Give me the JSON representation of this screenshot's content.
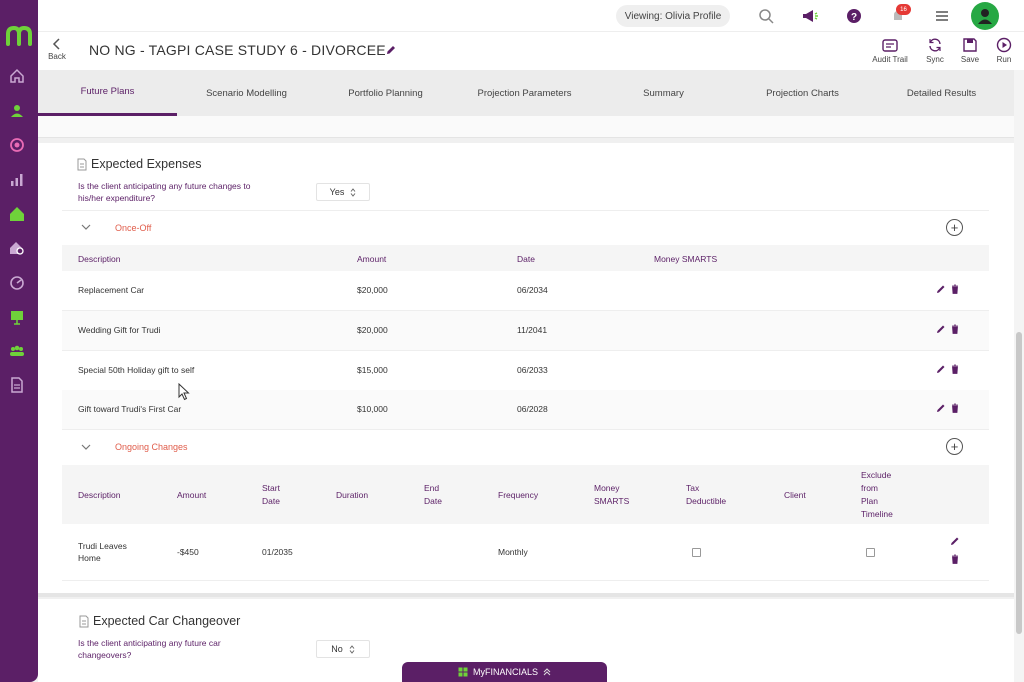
{
  "topbar": {
    "viewing": "Viewing: Olivia Profile",
    "notification_count": "16",
    "icons": [
      "search-icon",
      "megaphone-icon",
      "help-icon",
      "bell-icon",
      "menu-icon",
      "user-avatar-icon"
    ]
  },
  "header": {
    "back_label": "Back",
    "title": "NO NG - TAGPI CASE STUDY 6 - DIVORCEE",
    "tools": [
      {
        "label": "Audit Trail",
        "icon": "audit-trail-icon"
      },
      {
        "label": "Sync",
        "icon": "sync-icon"
      },
      {
        "label": "Save",
        "icon": "save-icon"
      },
      {
        "label": "Run",
        "icon": "run-icon"
      }
    ]
  },
  "tabs": [
    {
      "label": "Future Plans",
      "active": true
    },
    {
      "label": "Scenario Modelling"
    },
    {
      "label": "Portfolio Planning"
    },
    {
      "label": "Projection Parameters"
    },
    {
      "label": "Summary"
    },
    {
      "label": "Projection Charts"
    },
    {
      "label": "Detailed Results"
    }
  ],
  "expenses": {
    "title": "Expected Expenses",
    "question_line1": "Is the client anticipating any future changes to",
    "question_line2": "his/her expenditure?",
    "answer": "Yes",
    "once_off": {
      "label": "Once-Off",
      "headers": [
        "Description",
        "Amount",
        "Date",
        "Money SMARTS"
      ],
      "rows": [
        {
          "description": "Replacement Car",
          "amount": "$20,000",
          "date": "06/2034"
        },
        {
          "description": "Wedding Gift for Trudi",
          "amount": "$20,000",
          "date": "11/2041"
        },
        {
          "description": "Special 50th Holiday gift to self",
          "amount": "$15,000",
          "date": "06/2033"
        },
        {
          "description": "Gift toward Trudi's First Car",
          "amount": "$10,000",
          "date": "06/2028"
        }
      ]
    },
    "ongoing": {
      "label": "Ongoing Changes",
      "headers": {
        "description": "Description",
        "amount": "Amount",
        "start_1": "Start",
        "start_2": "Date",
        "duration": "Duration",
        "end_1": "End",
        "end_2": "Date",
        "frequency": "Frequency",
        "money_1": "Money",
        "money_2": "SMARTS",
        "tax_1": "Tax",
        "tax_2": "Deductible",
        "client": "Client",
        "excl_1": "Exclude",
        "excl_2": "from",
        "excl_3": "Plan",
        "excl_4": "Timeline"
      },
      "rows": [
        {
          "desc_1": "Trudi Leaves",
          "desc_2": "Home",
          "amount": "-$450",
          "start": "01/2035",
          "frequency": "Monthly",
          "tax_deductible": false,
          "exclude": false
        }
      ]
    }
  },
  "car": {
    "title": "Expected Car Changeover",
    "question_line1": "Is the client anticipating any future car",
    "question_line2": "changeovers?",
    "answer": "No"
  },
  "footer": {
    "label": "MyFINANCIALS"
  },
  "colors": {
    "brand": "#5b1f66",
    "accent_green": "#27a844",
    "group_label": "#e05d4b"
  }
}
